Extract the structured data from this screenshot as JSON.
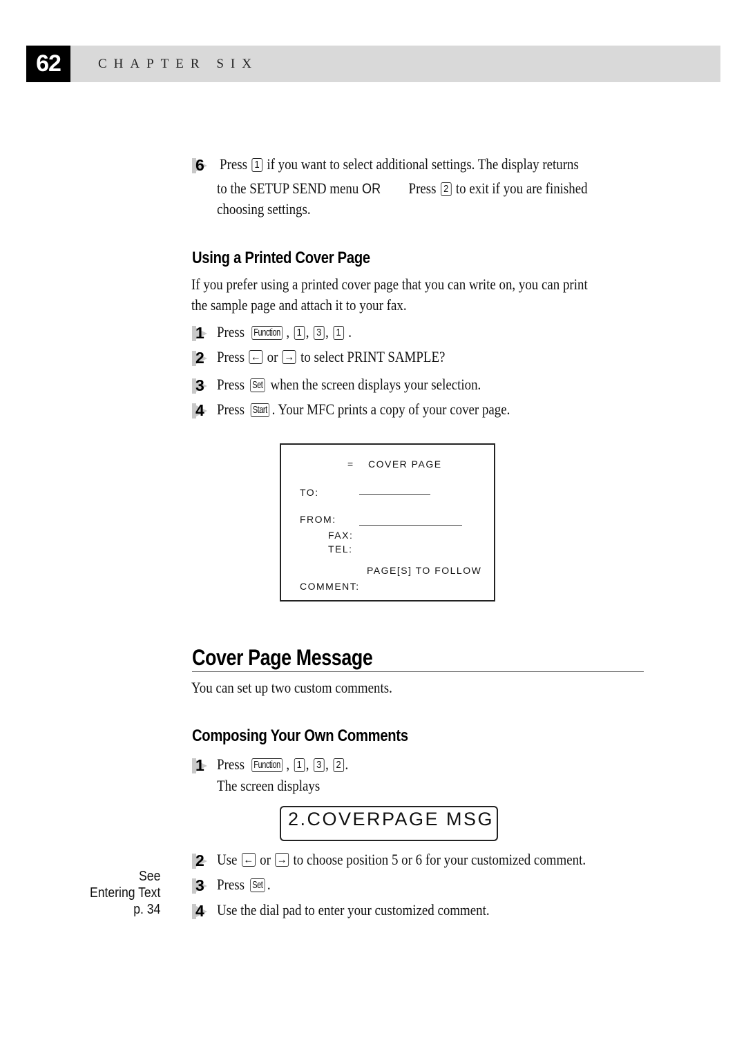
{
  "header": {
    "page_number": "62",
    "chapter": "CHAPTER SIX"
  },
  "step6": {
    "number": "6",
    "line1_pre": "Press",
    "line1_key": "1",
    "line1_post": "if you want to select additional settings. The display returns",
    "line2_pre": "to the SETUP SEND menu",
    "line2_or": "OR",
    "line2_press": "Press",
    "line2_key": "2",
    "line2_post": "to exit if you are finished",
    "line3": "choosing settings."
  },
  "printed_cover": {
    "heading": "Using a Printed Cover Page",
    "intro_line1": "If you prefer using a printed cover page that you can write on, you can print",
    "intro_line2": "the sample page and attach it to your fax.",
    "steps": [
      {
        "number": "1",
        "pre": "Press",
        "keys": [
          "Function",
          "1",
          "3",
          "1"
        ],
        "post": "."
      },
      {
        "number": "2",
        "pre": "Press",
        "key_left": "←",
        "or": "or",
        "key_right": "→",
        "post": "to select PRINT SAMPLE?"
      },
      {
        "number": "3",
        "pre": "Press",
        "key": "Set",
        "post": "when the screen displays your selection."
      },
      {
        "number": "4",
        "pre": "Press",
        "key": "Start",
        "post": ". Your MFC prints a copy of your cover page."
      }
    ]
  },
  "cover_sample": {
    "title_marker": "=",
    "title": "COVER PAGE",
    "to_label": "TO:",
    "from_label": "FROM:",
    "fax_label": "FAX:",
    "tel_label": "TEL:",
    "pages_label": "PAGE[S] TO FOLLOW",
    "comment_label": "COMMENT:"
  },
  "cover_message": {
    "heading": "Cover Page Message",
    "intro": "You can set up two custom comments."
  },
  "composing": {
    "heading": "Composing Your Own Comments",
    "step1": {
      "number": "1",
      "pre": "Press",
      "keys": [
        "Function",
        "1",
        "3",
        "2"
      ],
      "post": ".",
      "line2": "The screen displays"
    },
    "lcd_display": "2.COVERPAGE MSG",
    "step2": {
      "number": "2",
      "pre": "Use",
      "key_left": "←",
      "or": "or",
      "key_right": "→",
      "post": "to choose position 5 or 6 for your customized comment."
    },
    "step3": {
      "number": "3",
      "pre": "Press",
      "key": "Set",
      "post": "."
    },
    "step4": {
      "number": "4",
      "text": "Use the dial pad to enter your customized comment."
    }
  },
  "side_note": {
    "line1": "See",
    "line2": "Entering Text",
    "line3": "p. 34"
  }
}
